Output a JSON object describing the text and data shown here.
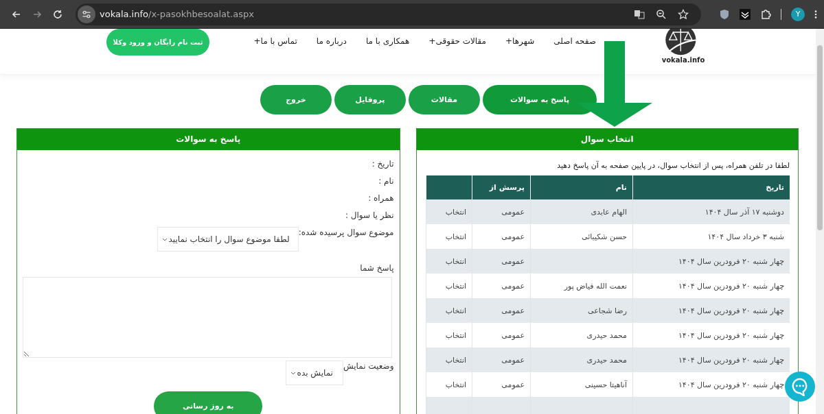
{
  "browser": {
    "url": {
      "host": "vokala.info",
      "path": "/x-pasokhbesoalat.aspx"
    },
    "profile_initial": "Y"
  },
  "header": {
    "logo_text": "vokala.info",
    "nav": [
      {
        "label": "صفحه اصلی"
      },
      {
        "label": "شهرها+"
      },
      {
        "label": "مقالات حقوقی+"
      },
      {
        "label": "همکاری با ما"
      },
      {
        "label": "درباره ما"
      },
      {
        "label": "تماس با ما+"
      }
    ],
    "signup_button": "ثبت نام رایگان و ورود وکلا"
  },
  "tabs": [
    {
      "label": "پاسخ به سوالات",
      "selected": true
    },
    {
      "label": "مقالات",
      "selected": false
    },
    {
      "label": "پروفایل",
      "selected": false
    },
    {
      "label": "خروج",
      "selected": false
    }
  ],
  "question_panel": {
    "title": "انتخاب سوال",
    "hint": "لطفا در تلفن همراه، پس از انتخاب سوال، در پایین صفحه به آن پاسخ دهید",
    "table": {
      "columns": [
        "تاریخ",
        "نام",
        "پرسش از"
      ],
      "rows": [
        {
          "date": "دوشنبه ۱۷ آذر سال ۱۴۰۴",
          "name": "الهام عابدی",
          "asked_from": "عمومی",
          "action": "انتخاب"
        },
        {
          "date": "شنبه ۳ خرداد سال ۱۴۰۴",
          "name": "حسن شکیبائی",
          "asked_from": "عمومی",
          "action": "انتخاب"
        },
        {
          "date": "چهار شنبه ۲۰ فرودرین سال ۱۴۰۴",
          "name": "",
          "asked_from": "عمومی",
          "action": "انتخاب"
        },
        {
          "date": "چهار شنبه ۲۰ فرودرین سال ۱۴۰۴",
          "name": "نعمت الله فیاض پور",
          "asked_from": "عمومی",
          "action": "انتخاب"
        },
        {
          "date": "چهار شنبه ۲۰ فرودرین سال ۱۴۰۴",
          "name": "رضا شجاعی",
          "asked_from": "عمومی",
          "action": "انتخاب"
        },
        {
          "date": "چهار شنبه ۲۰ فرودرین سال ۱۴۰۴",
          "name": "محمد حیدری",
          "asked_from": "عمومی",
          "action": "انتخاب"
        },
        {
          "date": "چهار شنبه ۲۰ فرودرین سال ۱۴۰۴",
          "name": "محمد حیدری",
          "asked_from": "عمومی",
          "action": "انتخاب"
        },
        {
          "date": "چهار شنبه ۲۰ فرودرین سال ۱۴۰۴",
          "name": "آناهیتا حسینی",
          "asked_from": "عمومی",
          "action": "انتخاب"
        }
      ]
    }
  },
  "answer_panel": {
    "title": "پاسخ به سوالات",
    "fields": [
      "تاریخ :",
      "نام :",
      "همراه :",
      "نظر یا سوال :"
    ],
    "topic_label": "موضوع سوال پرسیده شده:",
    "topic_select": "لطفا موضوع سوال را انتخاب نمایید",
    "answer_label": "پاسخ شما",
    "status_label": "وضعیت نمایش",
    "status_select": "نمایش بده",
    "submit_button": "به روز رسانی"
  }
}
